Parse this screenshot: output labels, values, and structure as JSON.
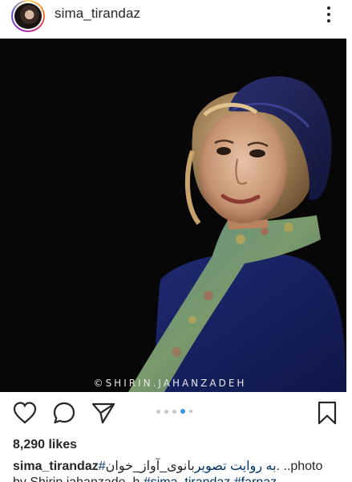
{
  "post": {
    "username": "sima_tirandaz",
    "watermark": "©SHIRIN.JAHANZADEH",
    "likes": "8,290 likes",
    "caption_user": "sima_tirandaz",
    "caption_tag": "#به روایت تصویر",
    "caption_text": "بانوی_آواز_خوان. ..photo",
    "caption_line2_prefix": "by Shirin.jahanzade_h",
    "caption_line2_tags": "#sima_tirandaz #farnaz",
    "carousel_count": 5,
    "carousel_active_index": 3
  },
  "icons": {
    "more": "more-vertical-icon",
    "like": "heart-outline-icon",
    "comment": "comment-bubble-icon",
    "share": "send-paper-plane-icon",
    "save": "bookmark-icon"
  },
  "colors": {
    "link": "#003569",
    "carousel_active": "#3897f0",
    "carousel_inactive": "#c7c7c7"
  }
}
